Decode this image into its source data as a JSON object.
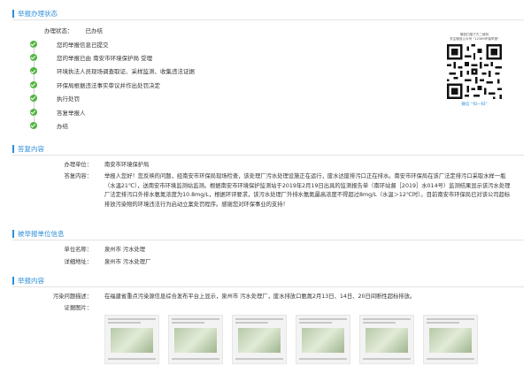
{
  "sections": {
    "status_title": "举报办理状态",
    "reply_title": "答复内容",
    "unit_title": "被举报单位信息",
    "report_title": "举报内容"
  },
  "status": {
    "label": "办理状态：",
    "value": "已办结"
  },
  "steps": [
    "您的举报信息已提交",
    "您的举报已由 南安市环境保护局 受理",
    "环境执法人员现场调查取证、采样监测、收集违法证据",
    "环保局根据违法事实审议并作出处罚决定",
    "执行处罚",
    "答复举报人",
    "办结"
  ],
  "qr": {
    "caption_1": "微信扫描下方二维码",
    "caption_2": "关注微信公众号 “12369环保举报”",
    "foot": "微信 “扫一扫”"
  },
  "reply": {
    "unit_label": "办理单位：",
    "unit_value": "南安市环境保护局",
    "content_label": "答复内容：",
    "content_value": "举报人您好！您反映的问题，经南安市环保局现场检查，该处理厂污水处理设施正在运行，废水达废排污口正在排水。南安市环保局在该厂法定排污口采取水样一瓶（水温21℃），送南安市环境监测站监测。根据南安市环境保护监测站于2019年2月19日出具的监测报告单（南环站督［2019］水014号）监测结果显示该污水处理厂法定排污口外排水氨氮浓度为10.8mg/L，根据环评要求，该污水处理厂外排水氨氮最高浓度不得超过8mg/L（水温＞12℃时）。目前南安市环保局已对该公司超标排放污染物的环境违法行为启动立案处罚程序。感谢您对环保事业的支持！"
  },
  "unit": {
    "name_label": "单位名称：",
    "name_value": "泉州市       污水处理",
    "addr_label": "详细地址：",
    "addr_value": "泉州市       污水处理厂"
  },
  "report": {
    "desc_label": "污染问题描述：",
    "desc_value": "在福建省重点污染源信息综合发布平台上显示，泉州市       污水处理厂，废水排放口氨氮2月13日、14日、20日间断性超标排放。",
    "photo_label": "证据图片："
  },
  "colors": {
    "accent": "#2f8fd8",
    "done": "#52b541"
  }
}
